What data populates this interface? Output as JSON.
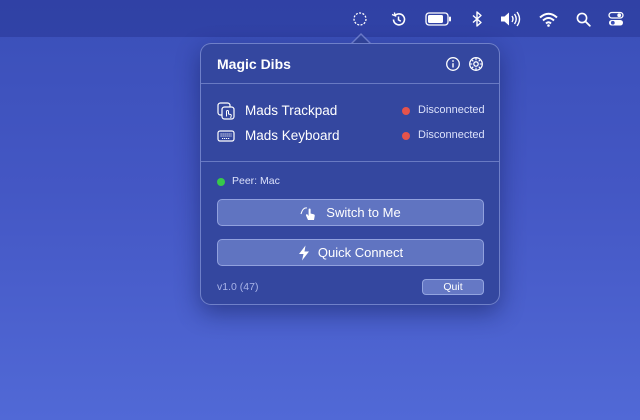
{
  "menubar": {
    "icons": [
      "magic-dibs-status-icon",
      "time-machine-icon",
      "battery-icon",
      "bluetooth-icon",
      "volume-icon",
      "wifi-icon",
      "spotlight-search-icon",
      "control-center-icon"
    ]
  },
  "popover": {
    "title": "Magic Dibs",
    "header_icons": [
      "info-icon",
      "settings-gear-icon"
    ],
    "devices": [
      {
        "name": "Mads Trackpad",
        "status": "Disconnected",
        "status_color": "#e5534b",
        "icon": "trackpad-icon"
      },
      {
        "name": "Mads Keyboard",
        "status": "Disconnected",
        "status_color": "#e5534b",
        "icon": "keyboard-icon"
      }
    ],
    "peer": {
      "label": "Peer: Mac",
      "color": "#37c94a"
    },
    "buttons": {
      "switch_label": "Switch to Me",
      "switch_icon": "hand-tap-icon",
      "quick_label": "Quick Connect",
      "quick_icon": "lightning-bolt-icon"
    },
    "version": "v1.0 (47)",
    "quit_label": "Quit"
  }
}
